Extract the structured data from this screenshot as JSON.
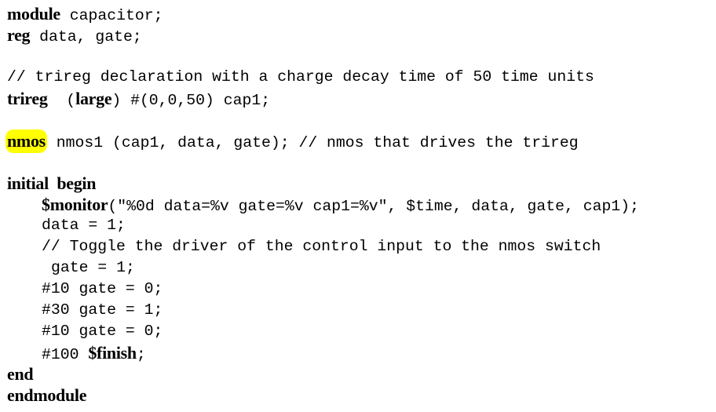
{
  "highlight_color": "#ffff00",
  "code": {
    "line1": {
      "kw": "module",
      "rest": " capacitor;"
    },
    "line2": {
      "kw": "reg",
      "rest": " data, gate;"
    },
    "line3": {
      "comment": "// trireg declaration with a charge decay time of 50 time units"
    },
    "line4": {
      "kw": "trireg",
      "mid_open": "  (",
      "kw2": "large",
      "rest": ") #(0,0,50) cap1;"
    },
    "line5": {
      "kw": "nmos",
      "rest": " nmos1 (cap1, data, gate); // nmos that drives the trireg"
    },
    "line6": {
      "kw": "initial",
      "kw2": "  begin"
    },
    "line7": {
      "kw": "$monitor",
      "rest": "(\"%0d data=%v gate=%v cap1=%v\", $time, data, gate, cap1);"
    },
    "line8": {
      "text": "data = 1;"
    },
    "line9": {
      "comment": "// Toggle the driver of the control input to the nmos switch"
    },
    "line10": {
      "text": "gate = 1;"
    },
    "line11": {
      "text": "#10 gate = 0;"
    },
    "line12": {
      "text": "#30 gate = 1;"
    },
    "line13": {
      "text": "#10 gate = 0;"
    },
    "line14": {
      "pre": "#100 ",
      "kw": "$finish",
      "rest": ";"
    },
    "line15": {
      "kw": "end"
    },
    "line16": {
      "kw": "endmodule"
    }
  }
}
